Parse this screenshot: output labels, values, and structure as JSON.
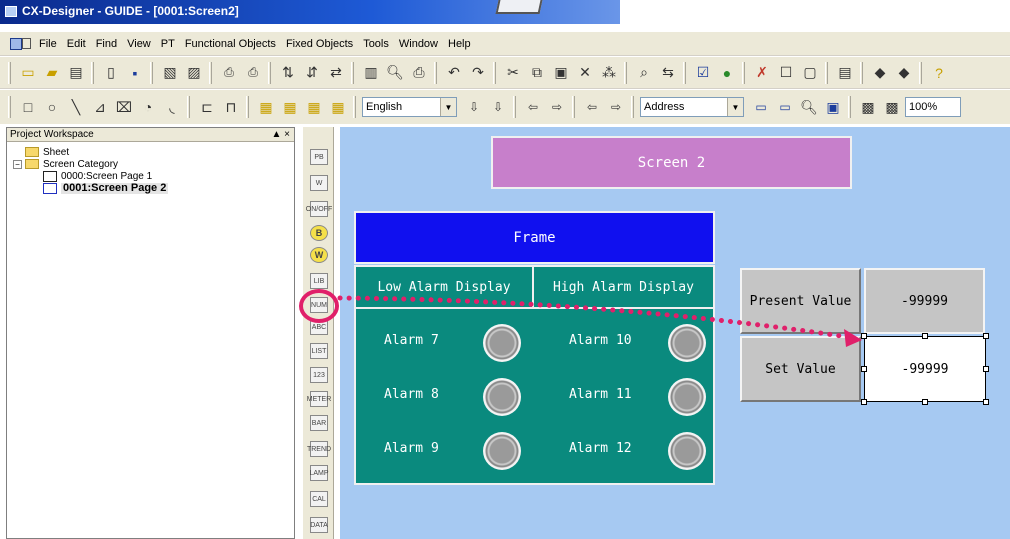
{
  "window": {
    "title": "CX-Designer - GUIDE - [0001:Screen2]"
  },
  "menu": [
    "File",
    "Edit",
    "Find",
    "View",
    "PT",
    "Functional Objects",
    "Fixed Objects",
    "Tools",
    "Window",
    "Help"
  ],
  "toolbar2": {
    "language": "English",
    "address": "Address",
    "zoom": "100%"
  },
  "workspace": {
    "title": "Project Workspace",
    "controls": "▲ ×",
    "tree": {
      "sheet": "Sheet",
      "category": "Screen Category",
      "page1": "0000:Screen Page 1",
      "page2": "0001:Screen Page 2"
    }
  },
  "palette": {
    "labels": [
      "PB",
      "W",
      "ON/OFF",
      "B",
      "W",
      "LIB",
      "NUM",
      "ABC",
      "LIST",
      "123",
      "METER",
      "BAR",
      "TREND",
      "LAMP",
      "CAL",
      "DATA"
    ]
  },
  "canvas": {
    "screen_title": "Screen 2",
    "frame_label": "Frame",
    "low_header": "Low Alarm Display",
    "high_header": "High Alarm Display",
    "alarms_low": [
      "Alarm 7",
      "Alarm 8",
      "Alarm 9"
    ],
    "alarms_high": [
      "Alarm 10",
      "Alarm 11",
      "Alarm 12"
    ],
    "present_value_label": "Present Value",
    "present_value": "-99999",
    "set_value_label": "Set Value",
    "set_value": "-99999"
  },
  "colors": {
    "canvas_bg": "#a6c9f2",
    "screen_title_bg": "#c77fcb",
    "frame_bg": "#1010ef",
    "alarm_panel_bg": "#0a8a7e",
    "highlight": "#e0206a"
  }
}
